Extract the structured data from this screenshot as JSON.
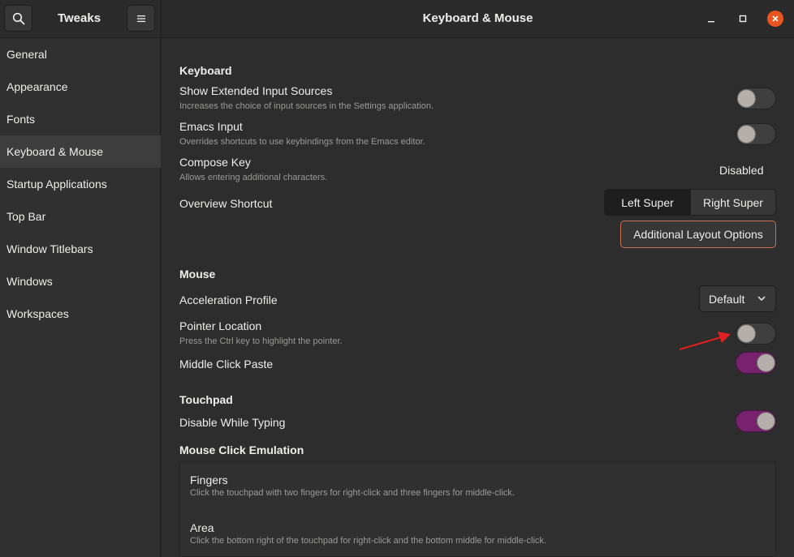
{
  "app": {
    "title": "Tweaks"
  },
  "window": {
    "title": "Keyboard & Mouse"
  },
  "colors": {
    "accent": "#77216f",
    "close_button": "#e95420",
    "highlight_border": "#c96f54",
    "annotation_arrow": "#e02020"
  },
  "icons": {
    "search": "search-icon",
    "menu": "hamburger-menu-icon",
    "minimize": "minimize-icon",
    "maximize": "maximize-icon",
    "close": "close-icon",
    "dropdown": "chevron-down-icon",
    "annotation": "red-arrow-icon"
  },
  "sidebar": {
    "selected": "Keyboard & Mouse",
    "items": [
      {
        "label": "General"
      },
      {
        "label": "Appearance"
      },
      {
        "label": "Fonts"
      },
      {
        "label": "Keyboard & Mouse"
      },
      {
        "label": "Startup Applications"
      },
      {
        "label": "Top Bar"
      },
      {
        "label": "Window Titlebars"
      },
      {
        "label": "Windows"
      },
      {
        "label": "Workspaces"
      }
    ]
  },
  "keyboard": {
    "section_title": "Keyboard",
    "extended_input": {
      "title": "Show Extended Input Sources",
      "description": "Increases the choice of input sources in the Settings application.",
      "enabled": false
    },
    "emacs_input": {
      "title": "Emacs Input",
      "description": "Overrides shortcuts to use keybindings from the Emacs editor.",
      "enabled": false
    },
    "compose_key": {
      "title": "Compose Key",
      "description": "Allows entering additional characters.",
      "value": "Disabled"
    },
    "overview_shortcut": {
      "title": "Overview Shortcut",
      "options": [
        "Left Super",
        "Right Super"
      ],
      "selected": "Left Super"
    },
    "layout_button": "Additional Layout Options"
  },
  "mouse": {
    "section_title": "Mouse",
    "acceleration_profile": {
      "title": "Acceleration Profile",
      "value": "Default"
    },
    "pointer_location": {
      "title": "Pointer Location",
      "description": "Press the Ctrl key to highlight the pointer.",
      "enabled": false
    },
    "middle_click_paste": {
      "title": "Middle Click Paste",
      "enabled": true
    }
  },
  "touchpad": {
    "section_title": "Touchpad",
    "disable_while_typing": {
      "title": "Disable While Typing",
      "enabled": true
    }
  },
  "click_emulation": {
    "section_title": "Mouse Click Emulation",
    "options": [
      {
        "title": "Fingers",
        "description": "Click the touchpad with two fingers for right-click and three fingers for middle-click."
      },
      {
        "title": "Area",
        "description": "Click the bottom right of the touchpad for right-click and the bottom middle for middle-click."
      }
    ]
  }
}
